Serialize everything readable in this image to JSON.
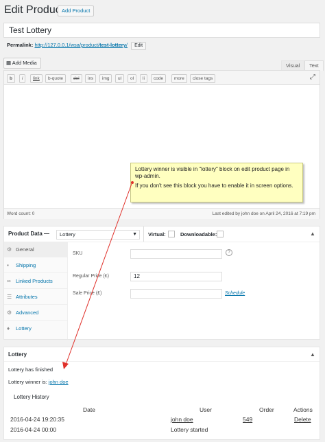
{
  "header": {
    "title": "Edit Product",
    "add_button": "Add Product"
  },
  "post_title": {
    "value": "Test Lottery"
  },
  "permalink": {
    "label": "Permalink:",
    "url_prefix": "http://127.0.0.1/wsa/product/",
    "url_slug": "test-lottery",
    "url_suffix": "/",
    "edit_label": "Edit"
  },
  "editor": {
    "add_media": "Add Media",
    "tab_visual": "Visual",
    "tab_text": "Text",
    "quicktags": [
      "b",
      "i",
      "link",
      "b-quote",
      "del",
      "ins",
      "img",
      "ul",
      "ol",
      "li",
      "code",
      "more",
      "close tags"
    ],
    "word_count": "Word count: 0",
    "last_edited": "Last edited by john doe on April 24, 2016 at 7:19 pm"
  },
  "annotation": {
    "line1": "Lottery winner is visible in \"lottery\" block on edit product page in wp-admin.",
    "line2": "If you don't see this block you have to enable it in screen options."
  },
  "product_data": {
    "label": "Product Data —",
    "type_selected": "Lottery",
    "virtual_label": "Virtual:",
    "downloadable_label": "Downloadable:",
    "tabs": [
      "General",
      "Shipping",
      "Linked Products",
      "Attributes",
      "Advanced",
      "Lottery"
    ],
    "sku_label": "SKU",
    "sku_help": "?",
    "regular_price_label": "Regular Price (£)",
    "regular_price_value": "12",
    "sale_price_label": "Sale Price (£)",
    "schedule_label": "Schedule"
  },
  "lottery_box": {
    "title": "Lottery",
    "status": "Lottery has finished",
    "winner_label": "Lottery winner is:",
    "winner_name": "john doe",
    "history_title": "Lottery History",
    "columns": [
      "Date",
      "User",
      "Order",
      "Actions"
    ],
    "rows": [
      {
        "date": "2016-04-24 19:20:35",
        "user": "john doe",
        "order": "549",
        "action": "Delete"
      },
      {
        "date": "2016-04-24 00:00",
        "user": "Lottery started",
        "order": "",
        "action": ""
      }
    ]
  },
  "colors": {
    "link": "#0073aa",
    "note_bg": "#ffffc0",
    "arrow": "#e0302a"
  }
}
